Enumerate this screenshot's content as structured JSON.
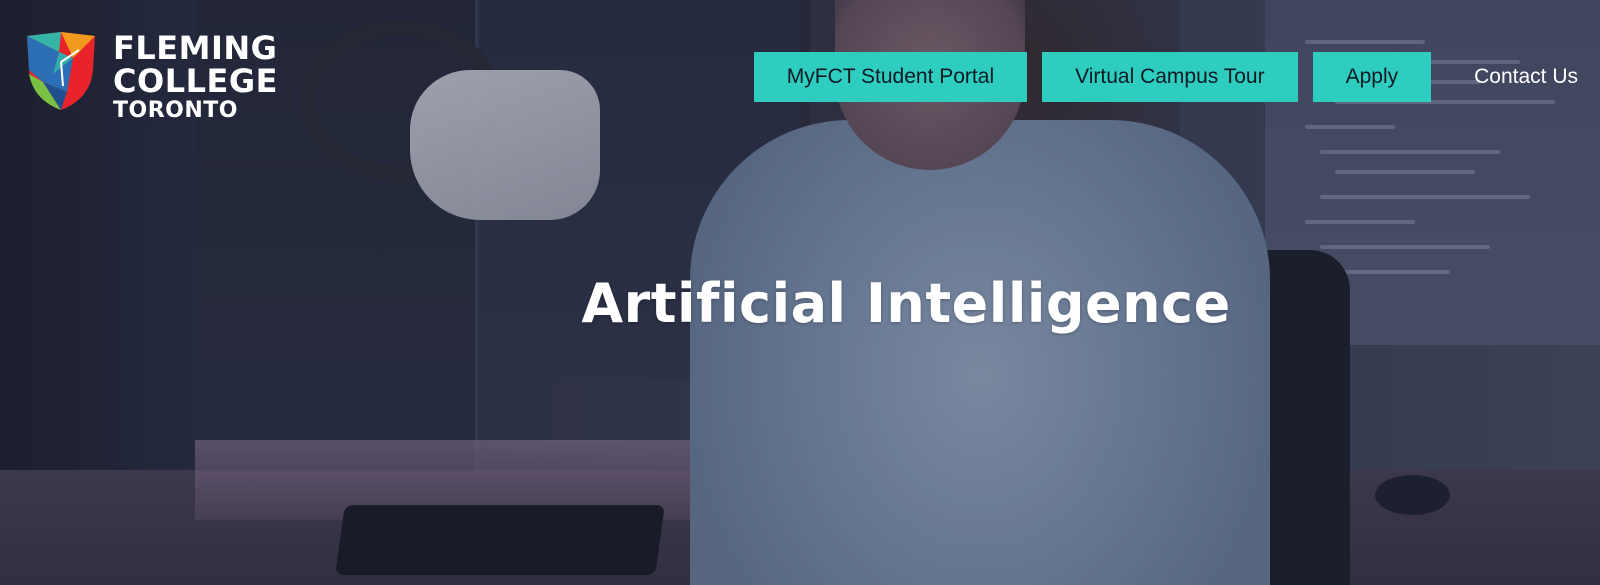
{
  "logo": {
    "line1": "FLEMING",
    "line2": "COLLEGE",
    "line3": "TORONTO",
    "colors": [
      "#e8232a",
      "#f29a1d",
      "#2b6fb6",
      "#35b5a6",
      "#7ac143"
    ]
  },
  "nav": {
    "buttons": [
      {
        "label": "MyFCT Student Portal"
      },
      {
        "label": "Virtual Campus Tour"
      },
      {
        "label": "Apply"
      }
    ],
    "contact_label": "Contact Us",
    "button_color": "#2fcdc0"
  },
  "hero": {
    "title": "Artificial Intelligence"
  }
}
